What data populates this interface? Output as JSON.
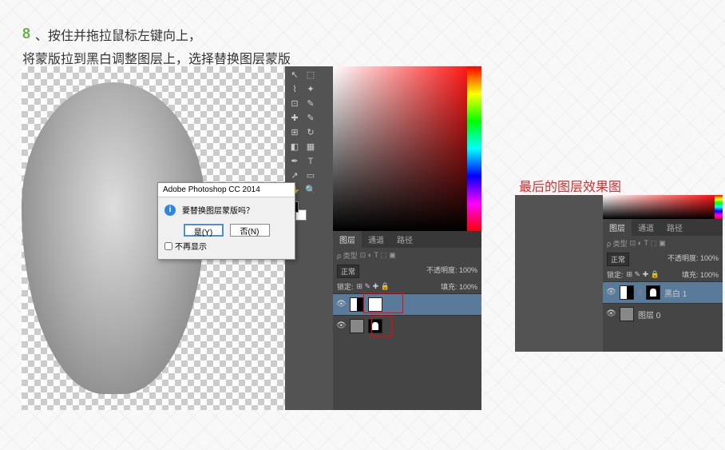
{
  "step_number": "8",
  "instruction_line1": "、按住并拖拉鼠标左键向上，",
  "instruction_line2": "将蒙版拉到黑白调整图层上，选择替换图层蒙版",
  "dialog": {
    "title": "Adobe Photoshop CC 2014",
    "message": "要替换图层蒙版吗？",
    "yes_btn": "是(Y)",
    "no_btn": "否(N)",
    "dont_show": "不再显示"
  },
  "panel": {
    "tabs": {
      "layers": "图层",
      "channels": "通道",
      "paths": "路径"
    },
    "kind_label": "ρ 类型",
    "blend_mode": "正常",
    "opacity_label": "不透明度:",
    "opacity_value": "100%",
    "lock_label": "锁定:",
    "fill_label": "填充:",
    "fill_value": "100%",
    "layer_bw": "黑白 1",
    "layer_bg": "图层 0"
  },
  "result": {
    "label": "最后的图层效果图"
  },
  "chart_data": null
}
